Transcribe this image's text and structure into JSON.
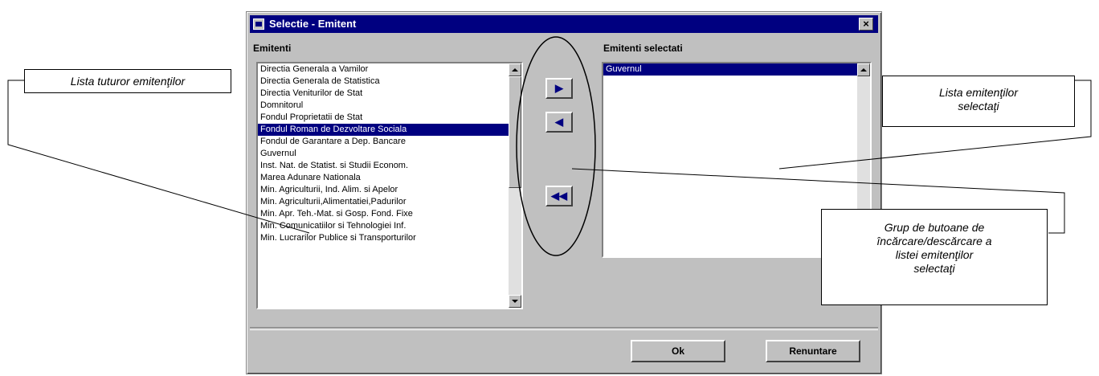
{
  "window": {
    "title": "Selectie - Emitent",
    "close_label": "×"
  },
  "left_panel": {
    "label": "Emitenti",
    "items": [
      "Directia Generala a Vamilor",
      "Directia Generala de Statistica",
      "Directia Veniturilor de Stat",
      "Domnitorul",
      "Fondul Proprietatii de Stat",
      "Fondul Roman de Dezvoltare Sociala",
      "Fondul de Garantare a Dep. Bancare",
      "Guvernul",
      "Inst. Nat. de Statist. si Studii Econom.",
      "Marea Adunare Nationala",
      "Min. Agriculturii, Ind. Alim. si Apelor",
      "Min. Agriculturii,Alimentatiei,Padurilor",
      "Min. Apr. Teh.-Mat. si Gosp. Fond. Fixe",
      "Min. Comunicatiilor si Tehnologiei Inf.",
      "Min. Lucrarilor Publice si Transporturilor"
    ],
    "selected_index": 5
  },
  "right_panel": {
    "label": "Emitenti selectati",
    "items": [
      "Guvernul"
    ]
  },
  "transfer_buttons": {
    "add": "▶",
    "remove": "◀",
    "remove_all": "◀◀"
  },
  "footer": {
    "ok_label": "Ok",
    "cancel_label": "Renuntare"
  },
  "annotations": {
    "all_issuers": "Lista tuturor emitenţilor",
    "selected_issuers_line1": "Lista emitenţilor",
    "selected_issuers_line2": "selectaţi",
    "button_group_line1": "Grup de butoane de",
    "button_group_line2": "încărcare/descărcare a",
    "button_group_line3": "listei emitenţilor",
    "button_group_line4": "selectaţi"
  }
}
